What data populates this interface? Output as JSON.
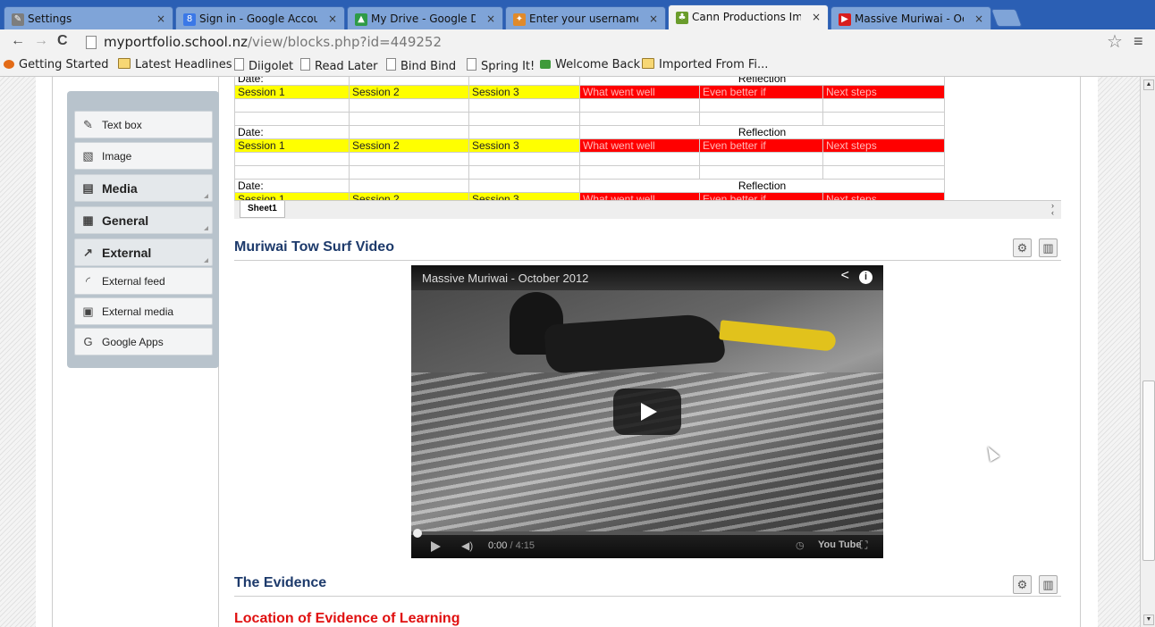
{
  "browser": {
    "tabs": [
      {
        "title": "Settings",
        "icon": "wrench-icon",
        "color": "#7d7d7d"
      },
      {
        "title": "Sign in - Google Accounts",
        "icon": "google-icon",
        "color": "#3b78e7"
      },
      {
        "title": "My Drive - Google Drive",
        "icon": "drive-icon",
        "color": "#2e9b47"
      },
      {
        "title": "Enter your username and",
        "icon": "feather-icon",
        "color": "#e08a2b"
      },
      {
        "title": "Cann Productions Impact",
        "icon": "leaf-icon",
        "color": "#6a9c2c"
      },
      {
        "title": "Massive Muriwai - Octobe",
        "icon": "youtube-icon",
        "color": "#d81d1d"
      }
    ],
    "url_host": "myportfolio.school.nz",
    "url_path": "/view/blocks.php?id=449252",
    "bookmarks": [
      {
        "label": "Getting Started",
        "icon": "firefox-icon"
      },
      {
        "label": "Latest Headlines",
        "icon": "folder-icon"
      },
      {
        "label": "Diigolet",
        "icon": "page-icon"
      },
      {
        "label": "Read Later",
        "icon": "page-icon"
      },
      {
        "label": "Bind Bind",
        "icon": "page-icon"
      },
      {
        "label": "Spring It!",
        "icon": "page-icon"
      },
      {
        "label": "Welcome Back",
        "icon": "green-app-icon"
      },
      {
        "label": "Imported From Fi...",
        "icon": "folder-icon"
      }
    ]
  },
  "palette": {
    "items": [
      {
        "label": "Text box",
        "type": "item",
        "icon": "textbox-icon"
      },
      {
        "label": "Image",
        "type": "item",
        "icon": "image-icon"
      },
      {
        "label": "Media",
        "type": "category",
        "icon": "film-icon"
      },
      {
        "label": "General",
        "type": "category",
        "icon": "list-icon"
      },
      {
        "label": "External",
        "type": "category",
        "icon": "external-icon"
      },
      {
        "label": "External feed",
        "type": "item",
        "icon": "rss-icon"
      },
      {
        "label": "External media",
        "type": "item",
        "icon": "external-media-icon"
      },
      {
        "label": "Google Apps",
        "type": "item",
        "icon": "google-g-icon"
      }
    ]
  },
  "sheet": {
    "date_label": "Date:",
    "reflection_label": "Reflection",
    "headers": [
      "Session 1",
      "Session 2",
      "Session 3",
      "What went well",
      "Even better if",
      "Next steps"
    ],
    "tab": "Sheet1"
  },
  "blocks": {
    "video_title": "Muriwai Tow Surf Video",
    "evidence_title": "The Evidence",
    "location_title": "Location of Evidence of Learning"
  },
  "video": {
    "title": "Massive Muriwai - October 2012",
    "current_time": "0:00",
    "duration": "/ 4:15",
    "brand": "You Tube",
    "progress": 0
  }
}
